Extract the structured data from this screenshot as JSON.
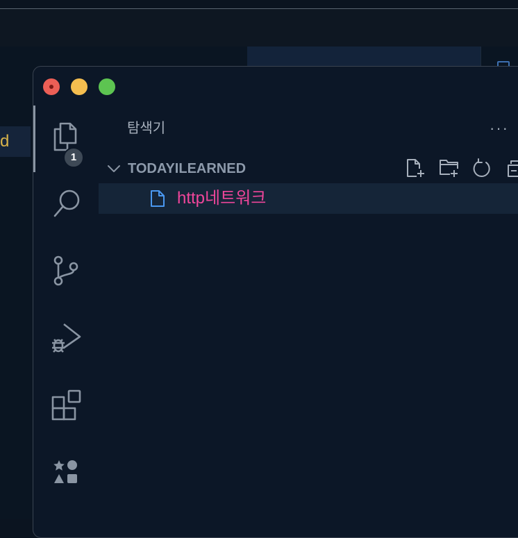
{
  "background": {
    "selected_item_partial": "d"
  },
  "window": {
    "controls": [
      "close",
      "minimize",
      "maximize"
    ]
  },
  "activity_bar": {
    "items": [
      {
        "name": "explorer",
        "icon": "files-icon",
        "badge": "1",
        "active": true
      },
      {
        "name": "search",
        "icon": "search-icon"
      },
      {
        "name": "source-control",
        "icon": "source-control-icon"
      },
      {
        "name": "run-and-debug",
        "icon": "run-debug-icon"
      },
      {
        "name": "extensions",
        "icon": "extensions-icon"
      },
      {
        "name": "custom",
        "icon": "shapes-icon"
      }
    ]
  },
  "sidebar": {
    "title": "탐색기",
    "more": "···",
    "folder": {
      "name": "TODAYILEARNED",
      "actions": [
        "new-file-icon",
        "new-folder-icon",
        "refresh-icon",
        "collapse-all-icon"
      ],
      "files": [
        {
          "name": "http네트워크",
          "icon": "file-icon",
          "selected": true
        }
      ]
    }
  },
  "colors": {
    "file_name": "#f0469b",
    "background_selected_text": "#d8b34a",
    "window_bg": "#0c1727"
  }
}
